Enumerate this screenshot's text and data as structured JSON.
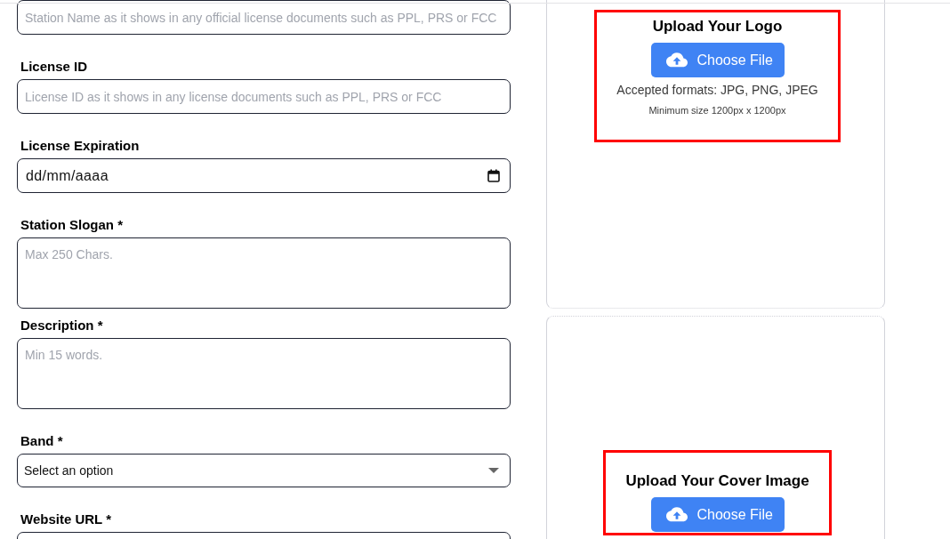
{
  "form": {
    "fields": [
      {
        "kind": "text",
        "placeholder": "Station Name as it shows in any official license documents such as PPL, PRS or FCC"
      },
      {
        "kind": "text",
        "label": "License ID",
        "placeholder": "License ID as it shows in any license documents such as PPL, PRS or FCC"
      },
      {
        "kind": "date",
        "label": "License Expiration",
        "value": "dd/mm/aaaa"
      },
      {
        "kind": "textarea",
        "label": "Station Slogan *",
        "placeholder": "Max 250 Chars."
      },
      {
        "kind": "textarea",
        "label": "Description *",
        "placeholder": "Min 15 words."
      },
      {
        "kind": "select",
        "label": "Band *",
        "value": "Select an option"
      },
      {
        "kind": "text",
        "label": "Website URL *"
      }
    ]
  },
  "uploads": [
    {
      "title": "Upload Your Logo",
      "button": "Choose File",
      "formats": "Accepted formats: JPG, PNG, JPEG",
      "min_size": "Minimum size 1200px x 1200px",
      "highlighted": true
    },
    {
      "title": "Upload Your Cover Image",
      "button": "Choose File",
      "highlighted": true
    }
  ]
}
